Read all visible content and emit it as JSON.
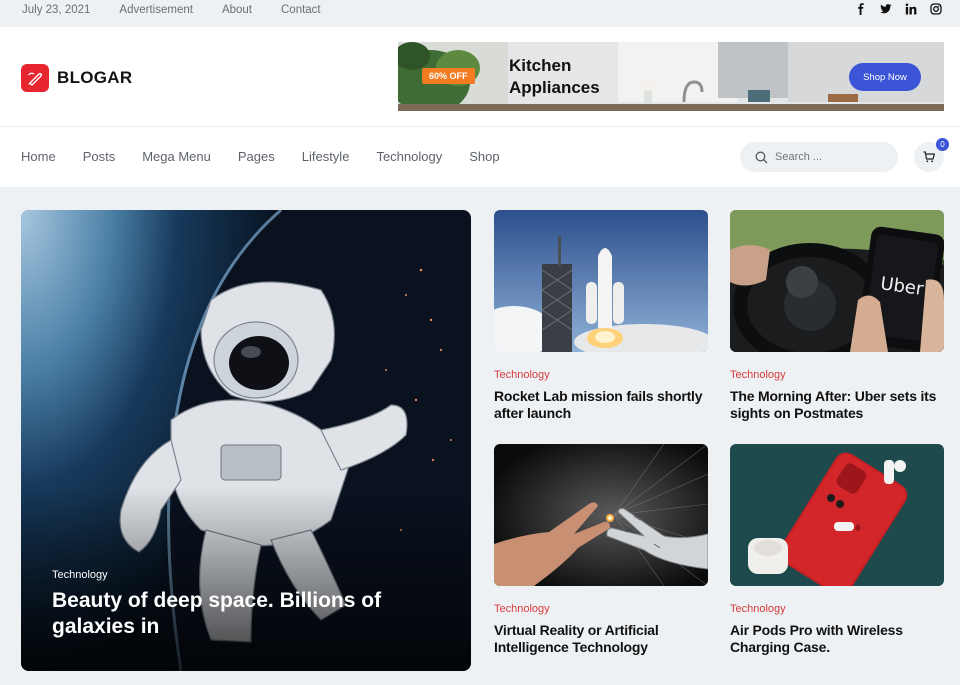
{
  "topbar": {
    "date": "July 23, 2021",
    "links": [
      "Advertisement",
      "About",
      "Contact"
    ],
    "social": [
      "facebook-icon",
      "twitter-icon",
      "linkedin-icon",
      "instagram-icon"
    ]
  },
  "brand": {
    "name": "BLOGAR",
    "accent": "#e7262f"
  },
  "ad": {
    "badge": "60% OFF",
    "title": "Kitchen Appliances",
    "cta": "Shop Now",
    "cta_color": "#3c55d6"
  },
  "nav": {
    "items": [
      "Home",
      "Posts",
      "Mega Menu",
      "Pages",
      "Lifestyle",
      "Technology",
      "Shop"
    ],
    "search_placeholder": "Search ...",
    "cart_count": "0"
  },
  "hero": {
    "category": "Technology",
    "title": "Beauty of deep space. Billions of galaxies in"
  },
  "cards": [
    {
      "category": "Technology",
      "title": "Rocket Lab mission fails shortly after launch",
      "image": "rocket-launch"
    },
    {
      "category": "Technology",
      "title": "The Morning After: Uber sets its sights on Postmates",
      "image": "uber-phone-steering-wheel",
      "image_text": "Uber"
    },
    {
      "category": "Technology",
      "title": "Virtual Reality or Artificial Intelligence Technology",
      "image": "human-robot-hands"
    },
    {
      "category": "Technology",
      "title": "Air Pods Pro with Wireless Charging Case.",
      "image": "red-iphone-airpods"
    }
  ],
  "colors": {
    "category_red": "#d63b3b",
    "page_bg": "#eef1f4"
  }
}
